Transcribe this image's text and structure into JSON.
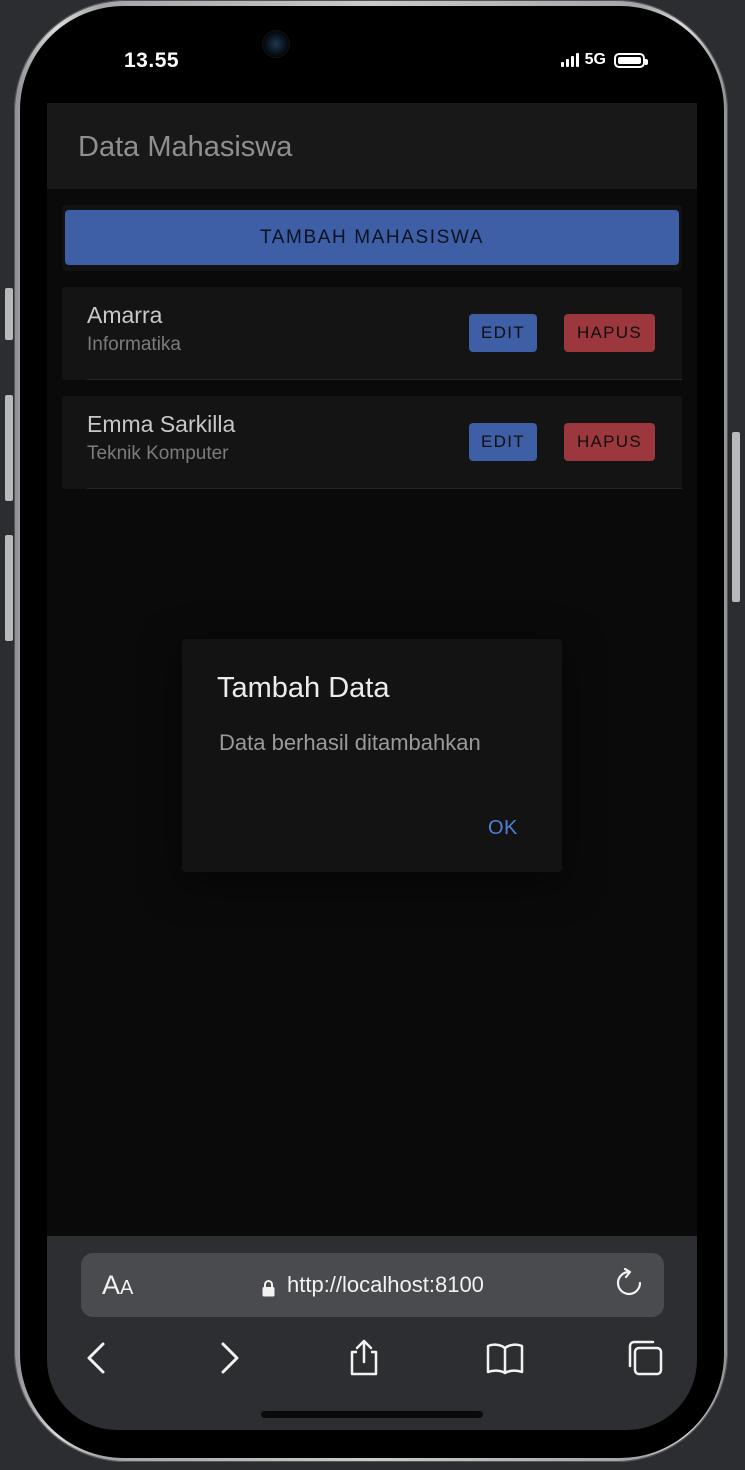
{
  "status": {
    "time": "13.55",
    "network": "5G"
  },
  "app": {
    "title": "Data Mahasiswa",
    "add_button": "TAMBAH MAHASISWA",
    "students": [
      {
        "name": "Amarra",
        "program": "Informatika",
        "edit_label": "EDIT",
        "delete_label": "HAPUS"
      },
      {
        "name": "Emma Sarkilla",
        "program": "Teknik Komputer",
        "edit_label": "EDIT",
        "delete_label": "HAPUS"
      }
    ]
  },
  "dialog": {
    "title": "Tambah Data",
    "message": "Data berhasil ditambahkan",
    "ok_label": "OK"
  },
  "browser": {
    "text_size_label_big": "A",
    "text_size_label_small": "A",
    "url": "http://localhost:8100",
    "icons": [
      "aa-icon",
      "lock-icon",
      "reload-icon",
      "back-icon",
      "forward-icon",
      "share-icon",
      "bookmarks-icon",
      "tabs-icon"
    ]
  },
  "colors": {
    "primary": "#3e5ea6",
    "danger": "#9c383d",
    "dialog_ok": "#4f7fd9"
  }
}
